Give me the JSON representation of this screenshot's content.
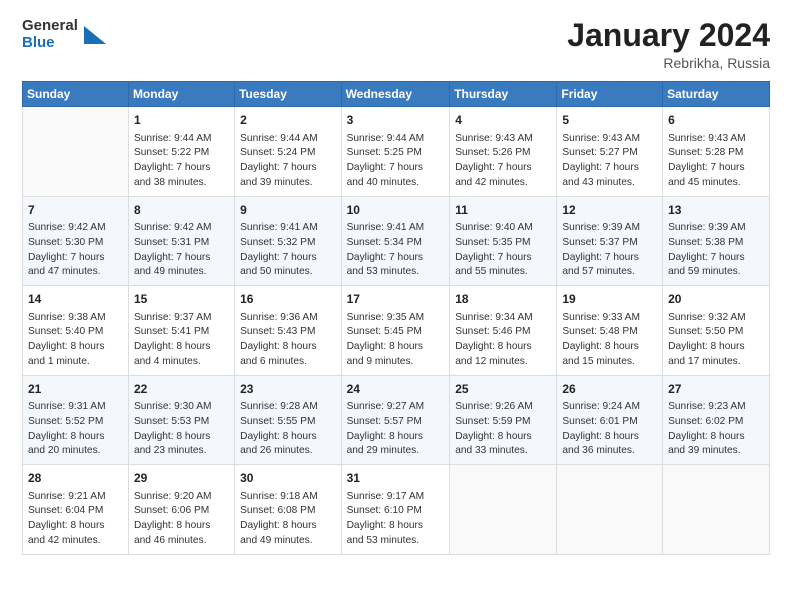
{
  "header": {
    "logo": {
      "general": "General",
      "blue": "Blue"
    },
    "month": "January 2024",
    "location": "Rebrikha, Russia"
  },
  "weekdays": [
    "Sunday",
    "Monday",
    "Tuesday",
    "Wednesday",
    "Thursday",
    "Friday",
    "Saturday"
  ],
  "weeks": [
    [
      {
        "day": "",
        "content": ""
      },
      {
        "day": "1",
        "content": "Sunrise: 9:44 AM\nSunset: 5:22 PM\nDaylight: 7 hours\nand 38 minutes."
      },
      {
        "day": "2",
        "content": "Sunrise: 9:44 AM\nSunset: 5:24 PM\nDaylight: 7 hours\nand 39 minutes."
      },
      {
        "day": "3",
        "content": "Sunrise: 9:44 AM\nSunset: 5:25 PM\nDaylight: 7 hours\nand 40 minutes."
      },
      {
        "day": "4",
        "content": "Sunrise: 9:43 AM\nSunset: 5:26 PM\nDaylight: 7 hours\nand 42 minutes."
      },
      {
        "day": "5",
        "content": "Sunrise: 9:43 AM\nSunset: 5:27 PM\nDaylight: 7 hours\nand 43 minutes."
      },
      {
        "day": "6",
        "content": "Sunrise: 9:43 AM\nSunset: 5:28 PM\nDaylight: 7 hours\nand 45 minutes."
      }
    ],
    [
      {
        "day": "7",
        "content": "Sunrise: 9:42 AM\nSunset: 5:30 PM\nDaylight: 7 hours\nand 47 minutes."
      },
      {
        "day": "8",
        "content": "Sunrise: 9:42 AM\nSunset: 5:31 PM\nDaylight: 7 hours\nand 49 minutes."
      },
      {
        "day": "9",
        "content": "Sunrise: 9:41 AM\nSunset: 5:32 PM\nDaylight: 7 hours\nand 50 minutes."
      },
      {
        "day": "10",
        "content": "Sunrise: 9:41 AM\nSunset: 5:34 PM\nDaylight: 7 hours\nand 53 minutes."
      },
      {
        "day": "11",
        "content": "Sunrise: 9:40 AM\nSunset: 5:35 PM\nDaylight: 7 hours\nand 55 minutes."
      },
      {
        "day": "12",
        "content": "Sunrise: 9:39 AM\nSunset: 5:37 PM\nDaylight: 7 hours\nand 57 minutes."
      },
      {
        "day": "13",
        "content": "Sunrise: 9:39 AM\nSunset: 5:38 PM\nDaylight: 7 hours\nand 59 minutes."
      }
    ],
    [
      {
        "day": "14",
        "content": "Sunrise: 9:38 AM\nSunset: 5:40 PM\nDaylight: 8 hours\nand 1 minute."
      },
      {
        "day": "15",
        "content": "Sunrise: 9:37 AM\nSunset: 5:41 PM\nDaylight: 8 hours\nand 4 minutes."
      },
      {
        "day": "16",
        "content": "Sunrise: 9:36 AM\nSunset: 5:43 PM\nDaylight: 8 hours\nand 6 minutes."
      },
      {
        "day": "17",
        "content": "Sunrise: 9:35 AM\nSunset: 5:45 PM\nDaylight: 8 hours\nand 9 minutes."
      },
      {
        "day": "18",
        "content": "Sunrise: 9:34 AM\nSunset: 5:46 PM\nDaylight: 8 hours\nand 12 minutes."
      },
      {
        "day": "19",
        "content": "Sunrise: 9:33 AM\nSunset: 5:48 PM\nDaylight: 8 hours\nand 15 minutes."
      },
      {
        "day": "20",
        "content": "Sunrise: 9:32 AM\nSunset: 5:50 PM\nDaylight: 8 hours\nand 17 minutes."
      }
    ],
    [
      {
        "day": "21",
        "content": "Sunrise: 9:31 AM\nSunset: 5:52 PM\nDaylight: 8 hours\nand 20 minutes."
      },
      {
        "day": "22",
        "content": "Sunrise: 9:30 AM\nSunset: 5:53 PM\nDaylight: 8 hours\nand 23 minutes."
      },
      {
        "day": "23",
        "content": "Sunrise: 9:28 AM\nSunset: 5:55 PM\nDaylight: 8 hours\nand 26 minutes."
      },
      {
        "day": "24",
        "content": "Sunrise: 9:27 AM\nSunset: 5:57 PM\nDaylight: 8 hours\nand 29 minutes."
      },
      {
        "day": "25",
        "content": "Sunrise: 9:26 AM\nSunset: 5:59 PM\nDaylight: 8 hours\nand 33 minutes."
      },
      {
        "day": "26",
        "content": "Sunrise: 9:24 AM\nSunset: 6:01 PM\nDaylight: 8 hours\nand 36 minutes."
      },
      {
        "day": "27",
        "content": "Sunrise: 9:23 AM\nSunset: 6:02 PM\nDaylight: 8 hours\nand 39 minutes."
      }
    ],
    [
      {
        "day": "28",
        "content": "Sunrise: 9:21 AM\nSunset: 6:04 PM\nDaylight: 8 hours\nand 42 minutes."
      },
      {
        "day": "29",
        "content": "Sunrise: 9:20 AM\nSunset: 6:06 PM\nDaylight: 8 hours\nand 46 minutes."
      },
      {
        "day": "30",
        "content": "Sunrise: 9:18 AM\nSunset: 6:08 PM\nDaylight: 8 hours\nand 49 minutes."
      },
      {
        "day": "31",
        "content": "Sunrise: 9:17 AM\nSunset: 6:10 PM\nDaylight: 8 hours\nand 53 minutes."
      },
      {
        "day": "",
        "content": ""
      },
      {
        "day": "",
        "content": ""
      },
      {
        "day": "",
        "content": ""
      }
    ]
  ]
}
